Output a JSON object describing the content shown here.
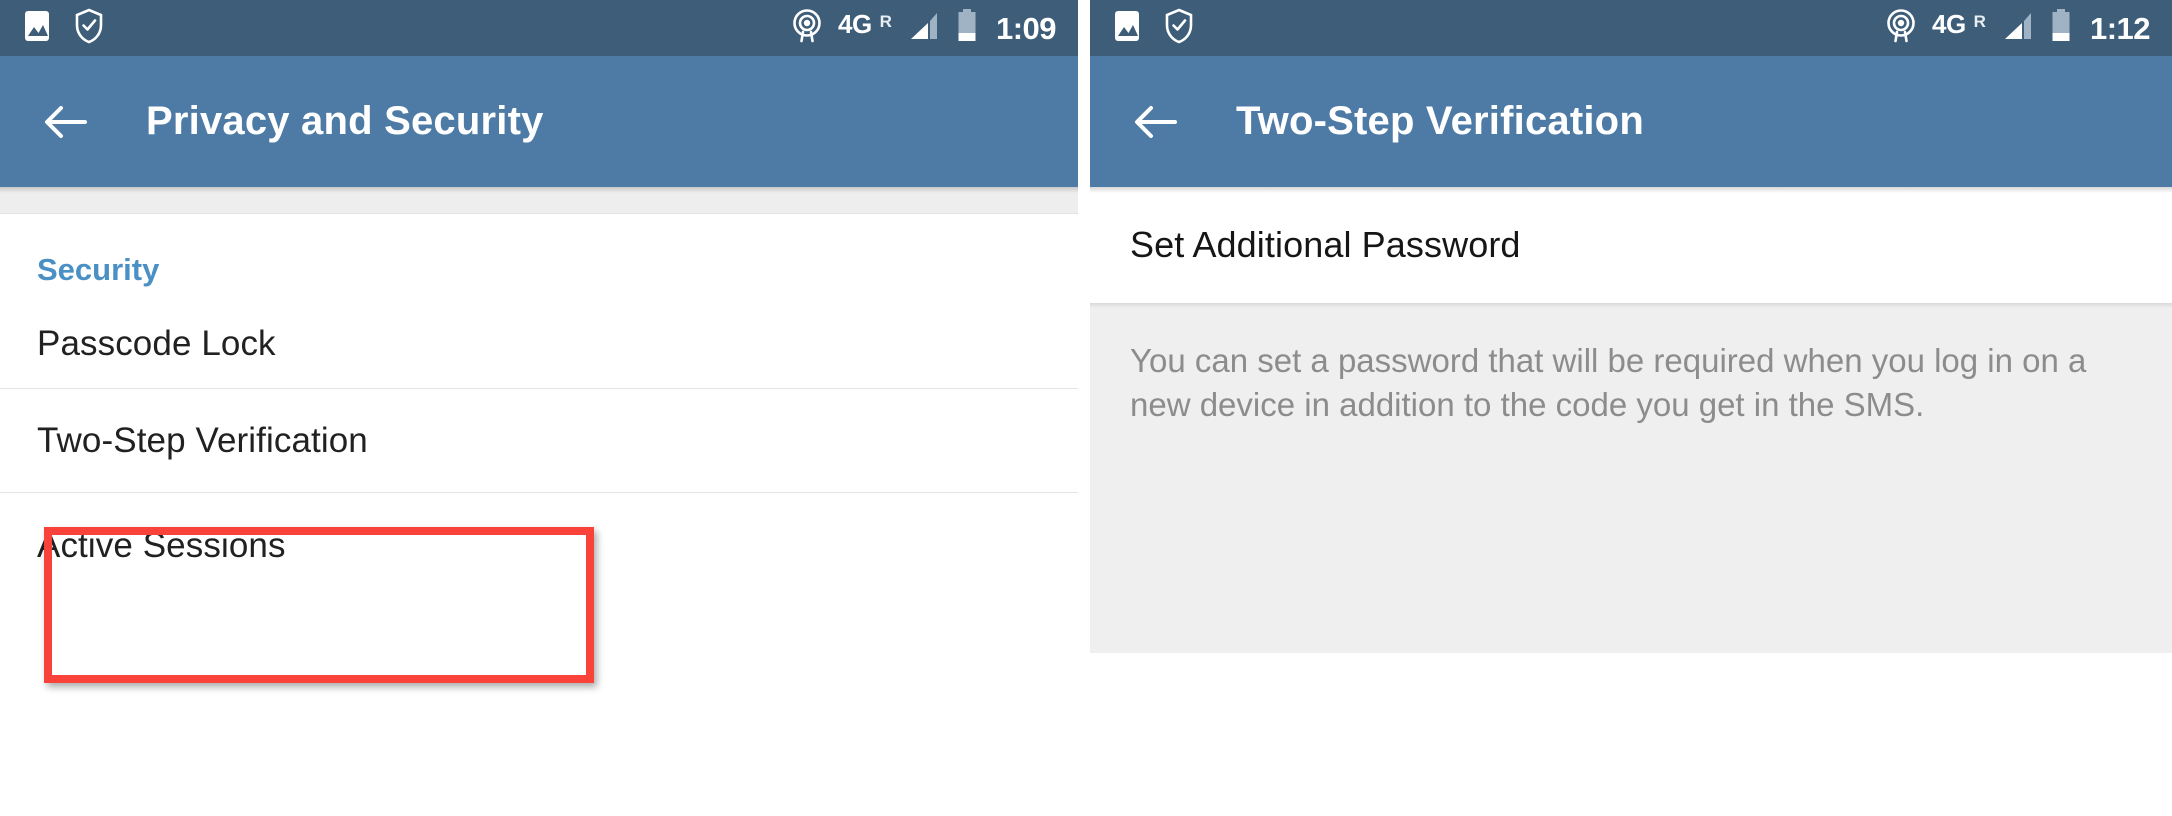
{
  "colors": {
    "statusbar_bg": "#3d5d78",
    "appbar_bg": "#4d7ba5",
    "accent_blue": "#4a90c4",
    "highlight_red": "#f9423a",
    "desc_bg": "#efefef",
    "body_text": "#212121",
    "desc_text": "#8c8c8c"
  },
  "left_panel": {
    "statusbar": {
      "icons_left": [
        "photo-icon",
        "shield-check-icon"
      ],
      "icons_right": [
        "hotspot-icon",
        "signal-triangle-icon",
        "battery-icon"
      ],
      "network": "4G",
      "roaming": "R",
      "time": "1:09"
    },
    "appbar": {
      "back_icon": "back-arrow-icon",
      "title": "Privacy and Security"
    },
    "section_title": "Security",
    "rows": [
      {
        "label": "Passcode Lock",
        "highlighted": false
      },
      {
        "label": "Two-Step Verification",
        "highlighted": true
      },
      {
        "label": "Active Sessions",
        "highlighted": false
      }
    ]
  },
  "right_panel": {
    "statusbar": {
      "icons_left": [
        "photo-icon",
        "shield-check-icon"
      ],
      "icons_right": [
        "hotspot-icon",
        "signal-triangle-icon",
        "battery-icon"
      ],
      "network": "4G",
      "roaming": "R",
      "time": "1:12"
    },
    "appbar": {
      "back_icon": "back-arrow-icon",
      "title": "Two-Step Verification"
    },
    "item_label": "Set Additional Password",
    "description": "You can set a password that will be required when you log in on a new device in addition to the code you get in the SMS."
  }
}
